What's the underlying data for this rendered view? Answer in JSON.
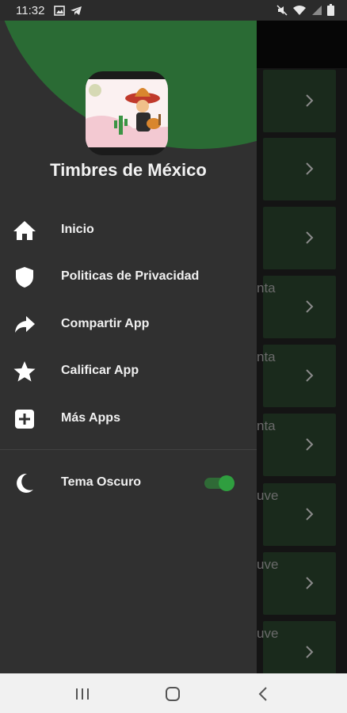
{
  "status_bar": {
    "time": "11:32",
    "icons": [
      "image-icon",
      "telegram-icon",
      "mute-icon",
      "wifi-icon",
      "signal-icon",
      "battery-icon"
    ]
  },
  "drawer": {
    "app_title": "Timbres de México",
    "menu_items": [
      {
        "label": "Inicio",
        "icon": "home-icon"
      },
      {
        "label": "Politicas de Privacidad",
        "icon": "shield-icon"
      },
      {
        "label": "Compartir App",
        "icon": "share-icon"
      },
      {
        "label": "Calificar App",
        "icon": "star-icon"
      },
      {
        "label": "Más Apps",
        "icon": "add-box-icon"
      }
    ],
    "theme_toggle": {
      "label": "Tema Oscuro",
      "icon": "moon-icon",
      "checked": true
    }
  },
  "background_list": {
    "visible_fragments": [
      "nta",
      "nta",
      "nta",
      "uve",
      "uve",
      "uve"
    ]
  },
  "nav_bar": {
    "icons": [
      "recents-icon",
      "home-circle-icon",
      "back-icon"
    ]
  },
  "colors": {
    "accent_green": "#2a6b34",
    "toggle_green": "#2f9e3f",
    "drawer_bg": "#303030",
    "text": "#f0f0f0"
  }
}
